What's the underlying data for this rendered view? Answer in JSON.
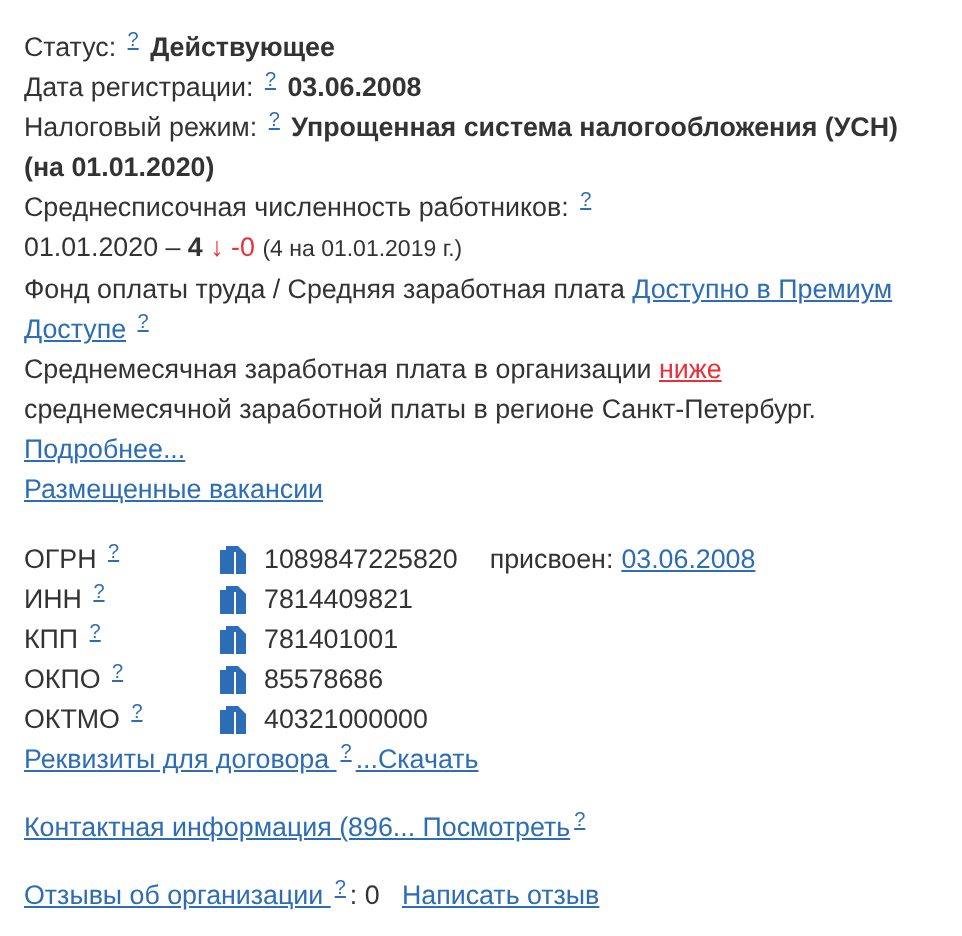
{
  "status": {
    "label": "Статус:",
    "help": "?",
    "value": "Действующее"
  },
  "registration": {
    "label": "Дата регистрации:",
    "help": "?",
    "value": "03.06.2008"
  },
  "tax_regime": {
    "label": "Налоговый режим:",
    "help": "?",
    "value_lines": [
      "Упрощенная система налогообложения (УСН)",
      "(на 01.01.2020)"
    ]
  },
  "employees": {
    "label": "Среднесписочная численность работников:",
    "help": "?",
    "date": "01.01.2020 –",
    "count": "4",
    "trend": "↓",
    "change": "-0",
    "previous": "(4 на 01.01.2019 г.)"
  },
  "payroll": {
    "label": "Фонд оплаты труда / Средняя заработная плата",
    "link_lines": [
      "Доступно в Премиум",
      "Доступе"
    ],
    "help": "?"
  },
  "salary": {
    "before": "Среднемесячная заработная плата в организации",
    "link": "ниже",
    "after": "среднемесячной заработной платы в регионе Санкт-Петербург."
  },
  "links": [
    "Подробнее...",
    "Размещенные вакансии"
  ],
  "codes": [
    {
      "label": "ОГРН",
      "help": "?",
      "value": "1089847225820",
      "assigned_label": "присвоен:",
      "assigned_date": "03.06.2008"
    },
    {
      "label": "ИНН",
      "help": "?",
      "value": "7814409821"
    },
    {
      "label": "КПП",
      "help": "?",
      "value": "781401001"
    },
    {
      "label": "ОКПО",
      "help": "?",
      "value": "85578686"
    },
    {
      "label": "ОКТМО",
      "help": "?",
      "value": "40321000000"
    }
  ],
  "requisites": {
    "link": "Реквизиты для договора ",
    "help": "?",
    "download": "...Скачать"
  },
  "contacts": {
    "link": "Контактная информация (896... Посмотреть",
    "help": "?"
  },
  "reviews": {
    "link": "Отзывы об организации ",
    "help": "?",
    "count": ": 0",
    "write": "Написать отзыв"
  }
}
